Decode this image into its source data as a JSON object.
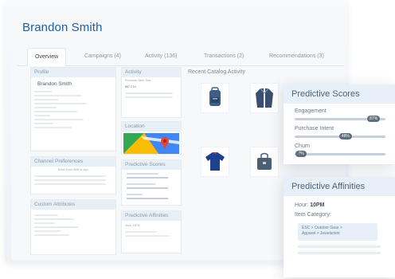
{
  "profile": {
    "name": "Brandon Smith"
  },
  "tabs": [
    {
      "label": "Overview"
    },
    {
      "label": "Campaigns (4)"
    },
    {
      "label": "Activity (136)"
    },
    {
      "label": "Transactions (2)"
    },
    {
      "label": "Recommendations (3)"
    }
  ],
  "cards": {
    "profile": "Profile",
    "channel_preferences": "Channel Preferences",
    "custom_attributes": "Custom Attributes",
    "activity": "Activity",
    "location": "Location",
    "predictive_scores": "Predictive Scores",
    "predictive_affinities": "Predictive Affinities",
    "recent_catalog_activity": "Recent Catalog Activity"
  },
  "small_text": {
    "profile_name": "Brandon Smith",
    "channel_cols": "Email  Push  SMS  In-App",
    "activity_cols": "Purchase   Visits   Time",
    "activity_vals": "$57       2        1h",
    "hour_small": "Hour: 10PM"
  },
  "popover_scores": {
    "title": "Predictive Scores",
    "metrics": [
      {
        "label": "Engagement",
        "value": "87%",
        "fraction": 0.87
      },
      {
        "label": "Purchase Intent",
        "value": "48%",
        "fraction": 0.56
      },
      {
        "label": "Churn",
        "value": "7%",
        "fraction": 0.07
      }
    ]
  },
  "popover_affinities": {
    "title": "Predictive Affinities",
    "hour_label": "Hour:",
    "hour_value": "10PM",
    "item_category_label": "Item Category:",
    "tag_text": "ESC > Outdoor Gear >\nApparel > Jewelsmint"
  },
  "colors": {
    "accent": "#1d5fa8",
    "header_bg": "#e7f0f8",
    "pill": "#5f6e7e"
  },
  "icons": [
    "backpack-icon",
    "jacket-icon",
    "tshirt-icon",
    "bag-icon",
    "map-icon"
  ]
}
